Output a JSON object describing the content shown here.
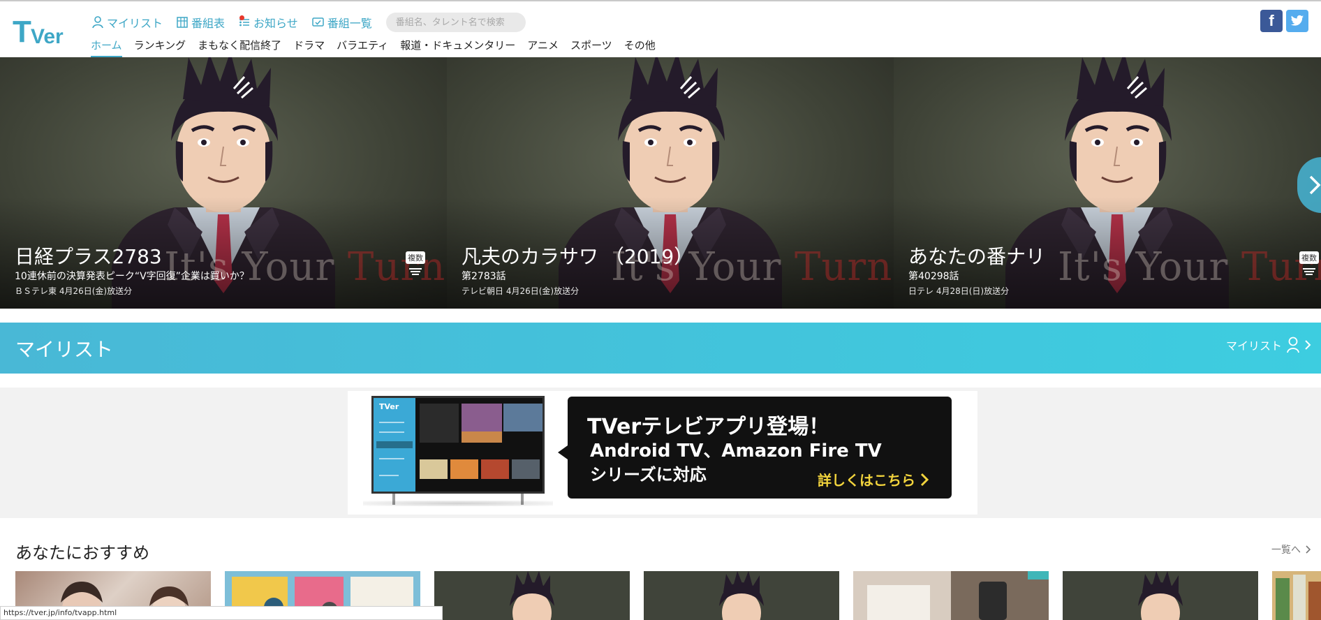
{
  "brand": {
    "logo_text": "TVer",
    "accent": "#3ea7c6"
  },
  "top_nav": [
    {
      "label": "マイリスト",
      "icon": "person-icon"
    },
    {
      "label": "番組表",
      "icon": "grid-icon"
    },
    {
      "label": "お知らせ",
      "icon": "list-icon"
    },
    {
      "label": "番組一覧",
      "icon": "tv-icon"
    }
  ],
  "search": {
    "placeholder": "番組名、タレント名で検索"
  },
  "categories": [
    "ホーム",
    "ランキング",
    "まもなく配信終了",
    "ドラマ",
    "バラエティ",
    "報道・ドキュメンタリー",
    "アニメ",
    "スポーツ",
    "その他"
  ],
  "active_category": "ホーム",
  "social": {
    "facebook": "f",
    "twitter": "twitter-icon"
  },
  "hero": {
    "slides": [
      {
        "title": "日経プラス2783",
        "subtitle": "10連休前の決算発表ピーク“V字回復”企業は買いか？",
        "meta": "ＢＳテレ東 4月26日(金)放送分",
        "watermark_a": "It's Your ",
        "watermark_b": "Turn",
        "badge": "複数"
      },
      {
        "title": "凡夫のカラサワ （2019）",
        "subtitle": "第2783話",
        "meta": "テレビ朝日 4月26日(金)放送分",
        "watermark_a": "It's Your ",
        "watermark_b": "Turn"
      },
      {
        "title": "あなたの番ナリ",
        "subtitle": "第40298話",
        "meta": "日テレ 4月28日(日)放送分",
        "watermark_a": "It's Your ",
        "watermark_b": "Turn",
        "badge": "複数"
      }
    ]
  },
  "mylist_band": {
    "title": "マイリスト",
    "link_label": "マイリスト"
  },
  "promo": {
    "line1": "TVerテレビアプリ登場！",
    "line2": "Android TV、Amazon Fire TV",
    "line3": "シリーズに対応",
    "cta": "詳しくはこちら",
    "screen_logo": "TVer"
  },
  "recommend": {
    "title": "あなたにおすすめ",
    "more_label": "一覧へ"
  },
  "status_url": "https://tver.jp/info/tvapp.html"
}
